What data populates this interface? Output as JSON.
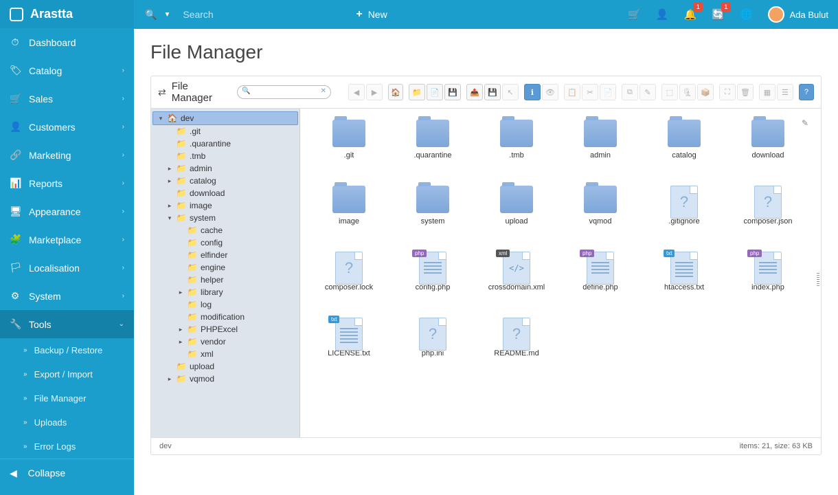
{
  "brand": "Arastta",
  "topbar": {
    "search_placeholder": "Search",
    "new_label": "New",
    "notif_badge": "1",
    "refresh_badge": "1",
    "user_name": "Ada Bulut"
  },
  "sidebar": {
    "items": [
      {
        "icon": "⏱",
        "label": "Dashboard",
        "expandable": false
      },
      {
        "icon": "🏷",
        "label": "Catalog",
        "expandable": true
      },
      {
        "icon": "🛒",
        "label": "Sales",
        "expandable": true
      },
      {
        "icon": "👤",
        "label": "Customers",
        "expandable": true
      },
      {
        "icon": "🔗",
        "label": "Marketing",
        "expandable": true
      },
      {
        "icon": "📊",
        "label": "Reports",
        "expandable": true
      },
      {
        "icon": "🖥",
        "label": "Appearance",
        "expandable": true
      },
      {
        "icon": "🧩",
        "label": "Marketplace",
        "expandable": true
      },
      {
        "icon": "🏳",
        "label": "Localisation",
        "expandable": true
      },
      {
        "icon": "⚙",
        "label": "System",
        "expandable": true
      },
      {
        "icon": "🔧",
        "label": "Tools",
        "expandable": true,
        "active": true
      }
    ],
    "tools_sub": [
      "Backup / Restore",
      "Export / Import",
      "File Manager",
      "Uploads",
      "Error Logs"
    ],
    "collapse": "Collapse"
  },
  "page_title": "File Manager",
  "fm": {
    "title": "File Manager",
    "search_value": "",
    "tree": {
      "root": "dev",
      "nodes": [
        {
          "label": ".git",
          "depth": 1,
          "arrow": "none"
        },
        {
          "label": ".quarantine",
          "depth": 1,
          "arrow": "none"
        },
        {
          "label": ".tmb",
          "depth": 1,
          "arrow": "none"
        },
        {
          "label": "admin",
          "depth": 1,
          "arrow": "right"
        },
        {
          "label": "catalog",
          "depth": 1,
          "arrow": "right"
        },
        {
          "label": "download",
          "depth": 1,
          "arrow": "none"
        },
        {
          "label": "image",
          "depth": 1,
          "arrow": "right"
        },
        {
          "label": "system",
          "depth": 1,
          "arrow": "down"
        },
        {
          "label": "cache",
          "depth": 2,
          "arrow": "none"
        },
        {
          "label": "config",
          "depth": 2,
          "arrow": "none"
        },
        {
          "label": "elfinder",
          "depth": 2,
          "arrow": "none"
        },
        {
          "label": "engine",
          "depth": 2,
          "arrow": "none"
        },
        {
          "label": "helper",
          "depth": 2,
          "arrow": "none"
        },
        {
          "label": "library",
          "depth": 2,
          "arrow": "right"
        },
        {
          "label": "log",
          "depth": 2,
          "arrow": "none"
        },
        {
          "label": "modification",
          "depth": 2,
          "arrow": "none"
        },
        {
          "label": "PHPExcel",
          "depth": 2,
          "arrow": "right"
        },
        {
          "label": "vendor",
          "depth": 2,
          "arrow": "right"
        },
        {
          "label": "xml",
          "depth": 2,
          "arrow": "none"
        },
        {
          "label": "upload",
          "depth": 1,
          "arrow": "none"
        },
        {
          "label": "vqmod",
          "depth": 1,
          "arrow": "right"
        }
      ]
    },
    "files": [
      {
        "name": ".git",
        "type": "folder"
      },
      {
        "name": ".quarantine",
        "type": "folder"
      },
      {
        "name": ".tmb",
        "type": "folder"
      },
      {
        "name": "admin",
        "type": "folder"
      },
      {
        "name": "catalog",
        "type": "folder"
      },
      {
        "name": "download",
        "type": "folder"
      },
      {
        "name": "image",
        "type": "folder"
      },
      {
        "name": "system",
        "type": "folder"
      },
      {
        "name": "upload",
        "type": "folder"
      },
      {
        "name": "vqmod",
        "type": "folder"
      },
      {
        "name": ".gitignore",
        "type": "unknown"
      },
      {
        "name": "composer.json",
        "type": "unknown"
      },
      {
        "name": "composer.lock",
        "type": "unknown"
      },
      {
        "name": "config.php",
        "type": "php"
      },
      {
        "name": "crossdomain.xml",
        "type": "xml"
      },
      {
        "name": "define.php",
        "type": "php"
      },
      {
        "name": "htaccess.txt",
        "type": "txt"
      },
      {
        "name": "index.php",
        "type": "php"
      },
      {
        "name": "LICENSE.txt",
        "type": "txt"
      },
      {
        "name": "php.ini",
        "type": "unknown"
      },
      {
        "name": "README.md",
        "type": "unknown"
      }
    ],
    "status_path": "dev",
    "status_info": "items: 21, size: 63 KB"
  }
}
